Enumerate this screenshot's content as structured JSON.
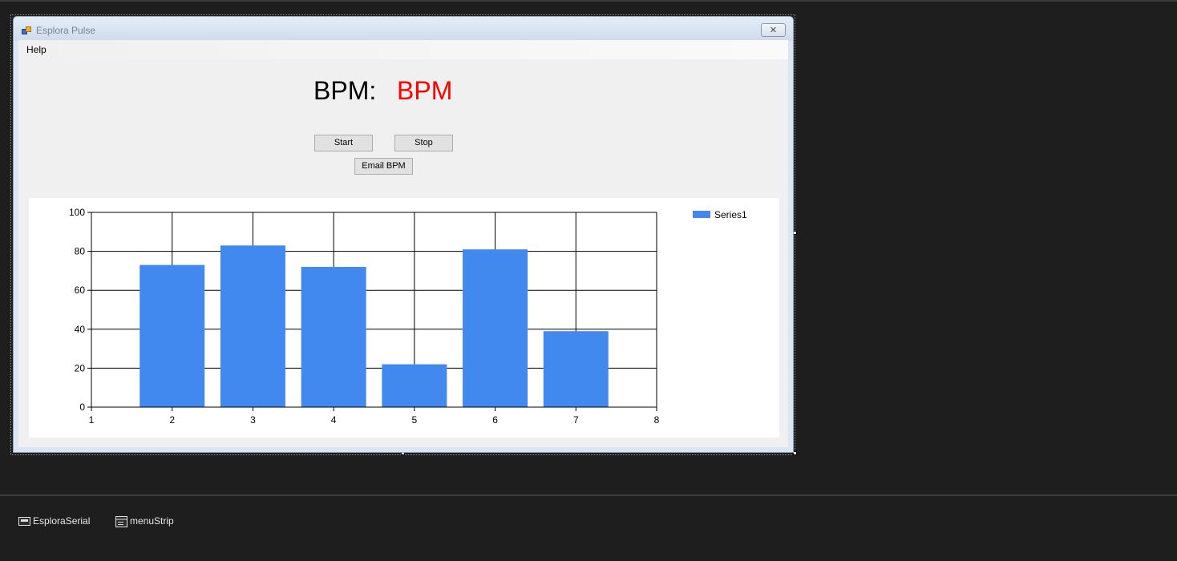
{
  "window": {
    "title": "Esplora Pulse",
    "close_glyph": "✕"
  },
  "menu": {
    "items": [
      {
        "label": "Help"
      }
    ]
  },
  "bpm": {
    "label": "BPM:",
    "value": "BPM",
    "value_color": "#ff0000"
  },
  "buttons": {
    "start": "Start",
    "stop": "Stop",
    "email": "Email BPM"
  },
  "chart_data": {
    "type": "bar",
    "x": [
      2,
      3,
      4,
      5,
      6,
      7
    ],
    "series": [
      {
        "name": "Series1",
        "values": [
          73,
          83,
          72,
          22,
          81,
          39
        ],
        "color": "#4189ee"
      }
    ],
    "xlim": [
      1,
      8
    ],
    "ylim": [
      0,
      100
    ],
    "xticks": [
      "1",
      "2",
      "3",
      "4",
      "5",
      "6",
      "7",
      "8"
    ],
    "yticks": [
      "0",
      "20",
      "40",
      "60",
      "80",
      "100"
    ],
    "grid": true,
    "legend": "top-right"
  },
  "tray": {
    "items": [
      {
        "label": "EsploraSerial",
        "icon": "serial-port-icon"
      },
      {
        "label": "menuStrip",
        "icon": "menustrip-icon"
      }
    ]
  }
}
